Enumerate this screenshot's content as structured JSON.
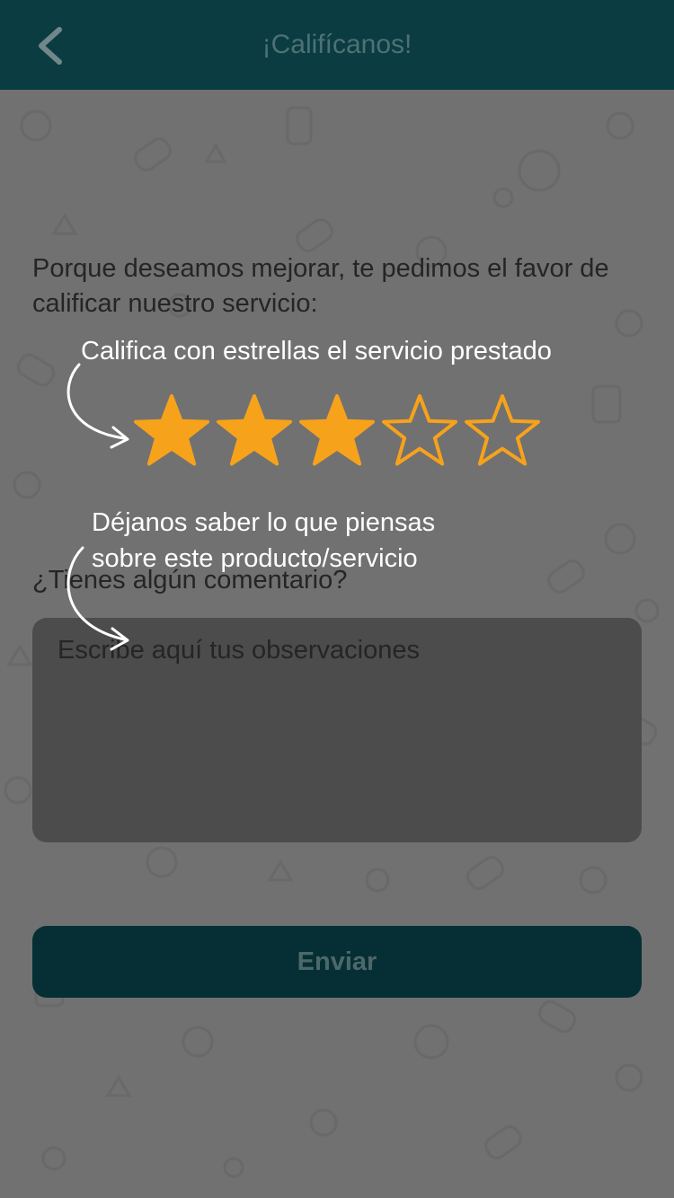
{
  "header": {
    "title": "¡Califícanos!",
    "back_icon": "chevron-left-icon",
    "background": "#0e4a50"
  },
  "intro": {
    "text": "Porque deseamos mejorar, te pedimos el favor de calificar nuestro servicio:"
  },
  "rating": {
    "hint": "Califica con estrellas el servicio prestado",
    "value": 3,
    "max": 5,
    "star_color": "#f7a21b"
  },
  "comment": {
    "hint_line1": "Déjanos saber lo que piensas",
    "hint_line2": "sobre este producto/servicio",
    "label": "¿Tienes algún comentario?",
    "placeholder": "Escribe aquí tus observaciones",
    "value": ""
  },
  "submit": {
    "label": "Enviar",
    "background": "#073a40"
  }
}
